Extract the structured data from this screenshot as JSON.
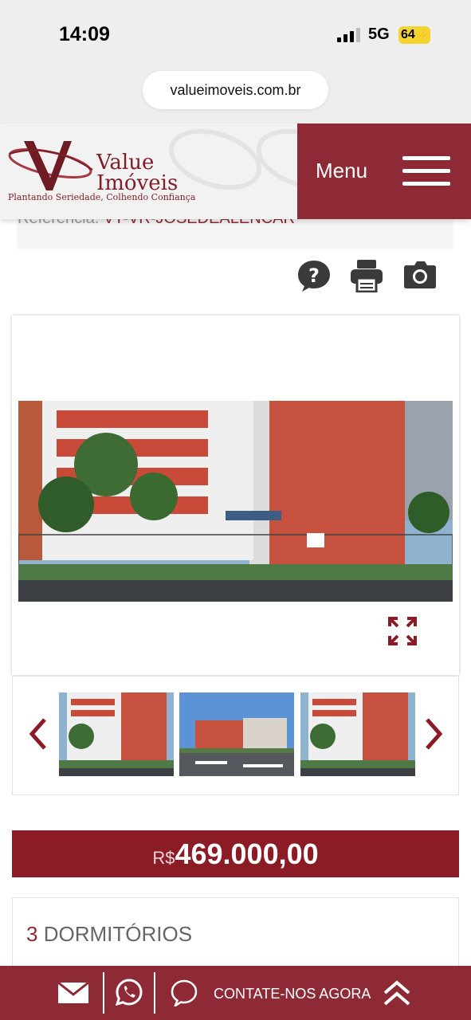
{
  "status_bar": {
    "time": "14:09",
    "network": "5G",
    "battery": "64"
  },
  "browser": {
    "url": "valueimoveis.com.br"
  },
  "header": {
    "logo_line1": "Value",
    "logo_line2": "Imóveis",
    "logo_slogan": "Plantando Seriedade, Colhendo Confiança",
    "menu_label": "Menu"
  },
  "reference": {
    "label": "Referência:",
    "code": "VT-VR-JOSEDEALENCAR"
  },
  "actions": {
    "icons": [
      "question-icon",
      "print-icon",
      "camera-icon"
    ]
  },
  "gallery": {
    "main_image": "building-photo",
    "thumbnail_count": 3
  },
  "price": {
    "currency": "R$",
    "value": "469.000,00"
  },
  "features": [
    {
      "count": "3",
      "label": "DORMITÓRIOS"
    }
  ],
  "contact_bar": {
    "label": "CONTATE-NOS AGORA"
  },
  "colors": {
    "brand": "#8d2a36",
    "price_bg": "#8b1b24"
  }
}
